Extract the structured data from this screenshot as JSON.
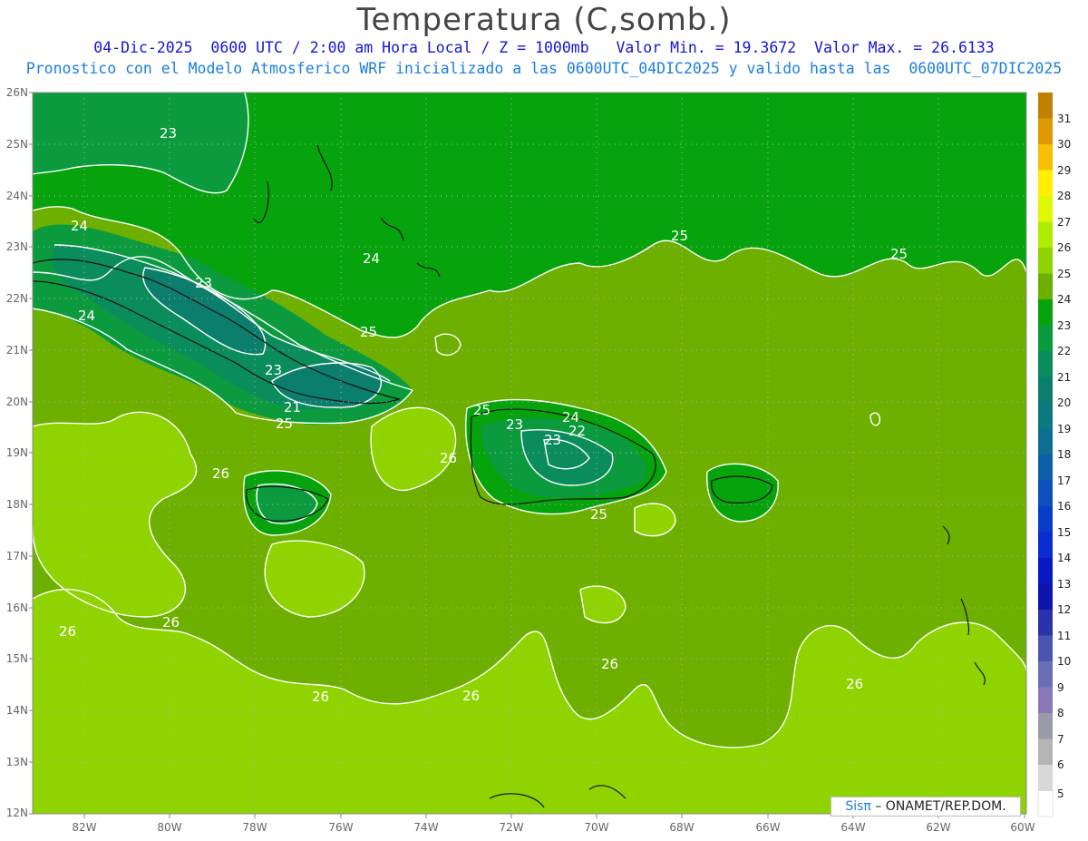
{
  "title": "Temperatura (C,somb.)",
  "subtitle1": "04-Dic-2025  0600 UTC / 2:00 am Hora Local / Z = 1000mb   Valor Min. = 19.3672  Valor Max. = 26.6133",
  "subtitle2": "Pronostico con el Modelo Atmosferico WRF inicializado a las 0600UTC_04DIC2025 y valido hasta las  0600UTC_07DIC2025",
  "credit_brand": "Sisπ",
  "credit_org": "– ONAMET/REP.DOM.",
  "lat_labels": [
    "26N",
    "25N",
    "24N",
    "23N",
    "22N",
    "21N",
    "20N",
    "19N",
    "18N",
    "17N",
    "16N",
    "15N",
    "14N",
    "13N",
    "12N"
  ],
  "lon_labels": [
    "82W",
    "80W",
    "78W",
    "76W",
    "74W",
    "72W",
    "70W",
    "68W",
    "66W",
    "64W",
    "62W",
    "60W"
  ],
  "colorbar_labels": [
    "31",
    "30",
    "29",
    "28",
    "27",
    "26",
    "25",
    "24",
    "23",
    "22",
    "21",
    "20",
    "19",
    "18",
    "17",
    "16",
    "15",
    "14",
    "13",
    "12",
    "11",
    "10",
    "9",
    "8",
    "7",
    "6",
    "5"
  ],
  "contour_labels": [
    "23",
    "24",
    "23",
    "24",
    "24",
    "23",
    "25",
    "25",
    "24",
    "25",
    "21",
    "25",
    "23",
    "25",
    "23",
    "22",
    "24",
    "26",
    "26",
    "25",
    "26",
    "26",
    "26",
    "26",
    "26",
    "26"
  ],
  "colors": {
    "c26": "#8fd400",
    "c25": "#6eb000",
    "c24": "#06a30c",
    "c23": "#0b9b3e",
    "c22": "#0a8c5c",
    "c21": "#0b7f6c",
    "contour": "#ffffff",
    "coast": "#111111"
  }
}
